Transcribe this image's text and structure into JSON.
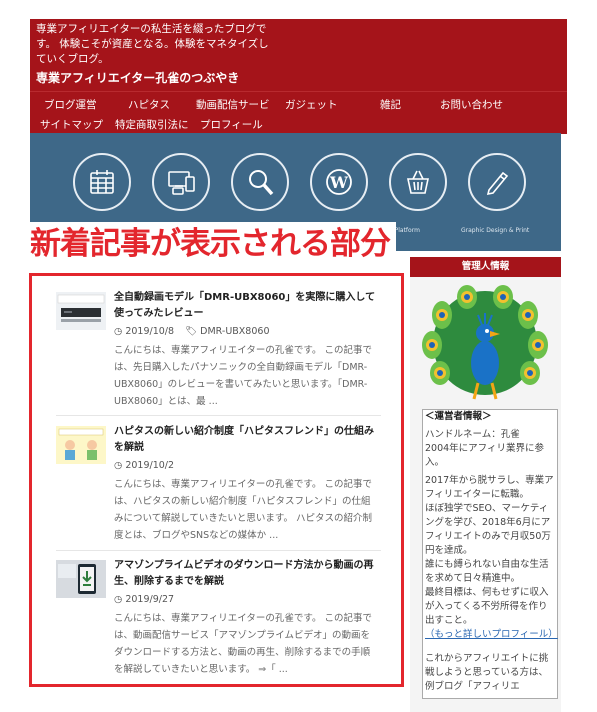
{
  "header": {
    "tagline": "専業アフィリエイターの私生活を綴ったブログです。 体験こそが資産となる。体験をマネタイズしていくブログ。",
    "site_title": "専業アフィリエイター孔雀のつぶやき"
  },
  "nav": {
    "items": [
      "ブログ運営",
      "ハピタス",
      "動画配信サービ",
      "ガジェット",
      "雑記",
      "お問い合わせ",
      "サイトマップ",
      "特定商取引法に",
      "プロフィール"
    ]
  },
  "banner": {
    "icons": [
      "calendar-icon",
      "devices-icon",
      "search-icon",
      "wordpress-icon",
      "basket-icon",
      "pencil-icon"
    ],
    "captions": [
      "mmerce Platform",
      "Graphic Design & Print"
    ]
  },
  "overlay_label": "新着記事が表示される部分",
  "posts": [
    {
      "title": "全自動録画モデル「DMR-UBX8060」を実際に購入して使ってみたレビュー",
      "date": "2019/10/8",
      "tag": "DMR-UBX8060",
      "excerpt": "こんにちは、専業アフィリエイターの孔雀です。 この記事では、先日購入したパナソニックの全自動録画モデル「DMR-UBX8060」のレビューを書いてみたいと思います。「DMR-UBX8060」とは、最 ..."
    },
    {
      "title": "ハピタスの新しい紹介制度「ハピタスフレンド」の仕組みを解説",
      "date": "2019/10/2",
      "tag": "",
      "excerpt": "こんにちは、専業アフィリエイターの孔雀です。 この記事では、ハピタスの新しい紹介制度「ハピタスフレンド」の仕組みについて解説していきたいと思います。 ハピタスの紹介制度とは、ブログやSNSなどの媒体か ..."
    },
    {
      "title": "アマゾンプライムビデオのダウンロード方法から動画の再生、削除するまでを解説",
      "date": "2019/9/27",
      "tag": "",
      "excerpt": "こんにちは、専業アフィリエイターの孔雀です。 この記事では、動画配信サービス「アマゾンプライムビデオ」の動画をダウンロードする方法と、動画の再生、削除するまでの手順を解説していきたいと思います。 ⇒「 ..."
    }
  ],
  "sidebar": {
    "header": "管理人情報",
    "profile_heading": "＜運営者情報＞",
    "profile_lines": [
      "ハンドルネーム：孔雀",
      "2004年にアフィリ業界に参入。",
      "2017年から脱サラし、専業アフィリエイターに転職。",
      "ほぼ独学でSEO、マーケティングを学び、2018年6月にアフィリエイトのみで月収50万円を達成。",
      "誰にも縛られない自由な生活を求めて日々精進中。",
      "最終目標は、何もせずに収入が入ってくる不労所得を作り出すこと。"
    ],
    "profile_link": "（もっと詳しいプロフィール）",
    "profile_tail": "これからアフィリエイトに挑戦しようと思っている方は、例ブログ「アフィリエ"
  },
  "colors": {
    "brand_red": "#a5141a",
    "highlight_red": "#e3262d",
    "banner_blue": "#3e6888"
  }
}
